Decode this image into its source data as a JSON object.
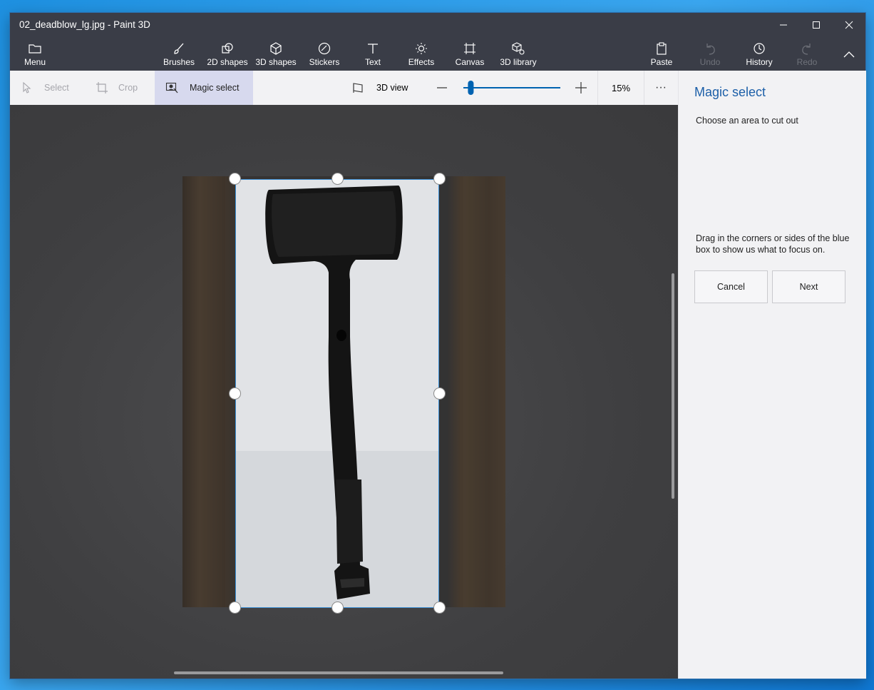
{
  "window": {
    "title": "02_deadblow_lg.jpg - Paint 3D",
    "controls": [
      "minimize-icon",
      "maximize-icon",
      "close-icon"
    ]
  },
  "toolbar": {
    "menu_label": "Menu",
    "tools": [
      {
        "label": "Brushes",
        "icon": "brush-icon"
      },
      {
        "label": "2D shapes",
        "icon": "2d-shapes-icon"
      },
      {
        "label": "3D shapes",
        "icon": "3d-shapes-icon"
      },
      {
        "label": "Stickers",
        "icon": "sticker-icon"
      },
      {
        "label": "Text",
        "icon": "text-icon"
      },
      {
        "label": "Effects",
        "icon": "effects-icon"
      },
      {
        "label": "Canvas",
        "icon": "canvas-icon"
      },
      {
        "label": "3D library",
        "icon": "3d-library-icon"
      }
    ],
    "paste_label": "Paste",
    "undo_label": "Undo",
    "history_label": "History",
    "redo_label": "Redo"
  },
  "subbar": {
    "select_label": "Select",
    "crop_label": "Crop",
    "magic_select_label": "Magic select",
    "view_3d_label": "3D view",
    "zoom_value": "15%",
    "zoom_level": 0.05,
    "more_label": "···"
  },
  "panel": {
    "title": "Magic select",
    "instruction": "Choose an area to cut out",
    "hint": "Drag in the corners or sides of the blue box to show us what to focus on.",
    "cancel_label": "Cancel",
    "next_label": "Next"
  },
  "colors": {
    "chrome": "#3a3d47",
    "accent": "#0063b1",
    "active_tab": "#d7d9ee",
    "selection_border": "#3a8fd6"
  }
}
